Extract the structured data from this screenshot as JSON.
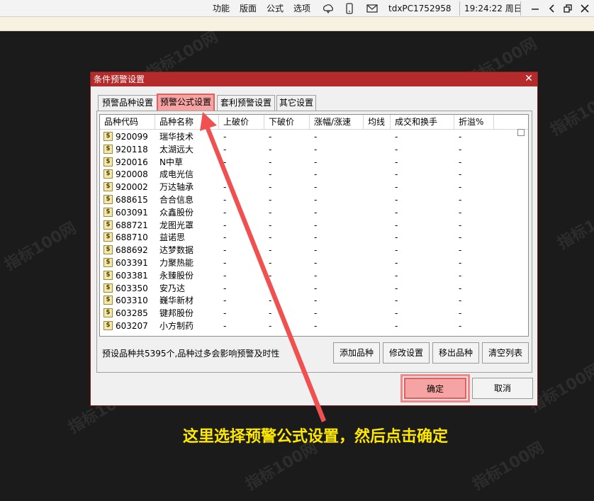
{
  "topbar": {
    "menu": [
      "功能",
      "版面",
      "公式",
      "选项"
    ],
    "host": "tdxPC1752958",
    "clock": "19:24:22 周日"
  },
  "dialog": {
    "title": "条件预警设置",
    "tabs": [
      "预警品种设置",
      "预警公式设置",
      "套利预警设置",
      "其它设置"
    ],
    "active_tab": 1,
    "columns": [
      "品种代码",
      "品种名称",
      "上破价",
      "下破价",
      "涨幅/涨速",
      "均线",
      "成交和换手",
      "折溢%"
    ],
    "rows": [
      {
        "code": "920099",
        "name": "瑞华技术",
        "up": "-",
        "down": "-",
        "chg": "-",
        "ma": "",
        "vol": "-",
        "prem": "-"
      },
      {
        "code": "920118",
        "name": "太湖远大",
        "up": "-",
        "down": "-",
        "chg": "-",
        "ma": "",
        "vol": "-",
        "prem": "-"
      },
      {
        "code": "920016",
        "name": "N中草",
        "up": "-",
        "down": "-",
        "chg": "-",
        "ma": "",
        "vol": "-",
        "prem": "-"
      },
      {
        "code": "920008",
        "name": "成电光信",
        "up": "-",
        "down": "-",
        "chg": "-",
        "ma": "",
        "vol": "-",
        "prem": "-"
      },
      {
        "code": "920002",
        "name": "万达轴承",
        "up": "-",
        "down": "-",
        "chg": "-",
        "ma": "",
        "vol": "-",
        "prem": "-"
      },
      {
        "code": "688615",
        "name": "合合信息",
        "up": "-",
        "down": "-",
        "chg": "-",
        "ma": "",
        "vol": "-",
        "prem": "-"
      },
      {
        "code": "603091",
        "name": "众鑫股份",
        "up": "-",
        "down": "-",
        "chg": "-",
        "ma": "",
        "vol": "-",
        "prem": "-"
      },
      {
        "code": "688721",
        "name": "龙图光罩",
        "up": "-",
        "down": "-",
        "chg": "-",
        "ma": "",
        "vol": "-",
        "prem": "-"
      },
      {
        "code": "688710",
        "name": "益诺思",
        "up": "-",
        "down": "-",
        "chg": "-",
        "ma": "",
        "vol": "-",
        "prem": "-"
      },
      {
        "code": "688692",
        "name": "达梦数据",
        "up": "-",
        "down": "-",
        "chg": "-",
        "ma": "",
        "vol": "-",
        "prem": "-"
      },
      {
        "code": "603391",
        "name": "力聚热能",
        "up": "-",
        "down": "-",
        "chg": "-",
        "ma": "",
        "vol": "-",
        "prem": "-"
      },
      {
        "code": "603381",
        "name": "永臻股份",
        "up": "-",
        "down": "-",
        "chg": "-",
        "ma": "",
        "vol": "-",
        "prem": "-"
      },
      {
        "code": "603350",
        "name": "安乃达",
        "up": "-",
        "down": "-",
        "chg": "-",
        "ma": "",
        "vol": "-",
        "prem": "-"
      },
      {
        "code": "603310",
        "name": "巍华新材",
        "up": "-",
        "down": "-",
        "chg": "-",
        "ma": "",
        "vol": "-",
        "prem": "-"
      },
      {
        "code": "603285",
        "name": "键邦股份",
        "up": "-",
        "down": "-",
        "chg": "-",
        "ma": "",
        "vol": "-",
        "prem": "-"
      },
      {
        "code": "603207",
        "name": "小方制药",
        "up": "-",
        "down": "-",
        "chg": "-",
        "ma": "",
        "vol": "-",
        "prem": "-"
      }
    ],
    "status": "预设品种共5395个,品种过多会影响预警及时性",
    "buttons": {
      "add": "添加品种",
      "edit": "修改设置",
      "remove": "移出品种",
      "clear": "清空列表",
      "ok": "确定",
      "cancel": "取消"
    }
  },
  "annotation": "这里选择预警公式设置，然后点击确定",
  "watermark": "指标100网",
  "colors": {
    "title_bar": "#b52a2a",
    "highlight": "#f6a3a3",
    "arrow": "#f05050",
    "annotation": "#ffe800"
  }
}
